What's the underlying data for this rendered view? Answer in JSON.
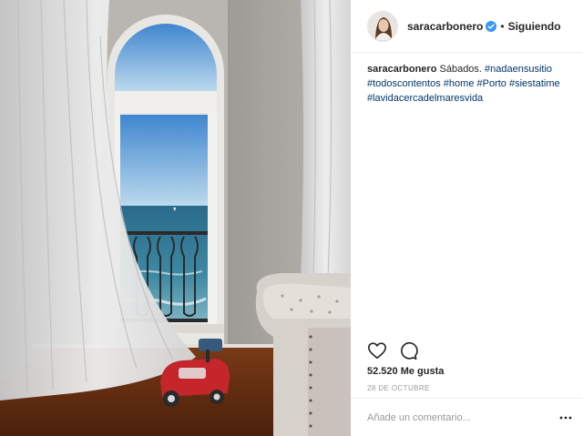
{
  "post": {
    "username": "saracarbonero",
    "separator": "•",
    "follow_state": "Siguiendo",
    "caption": {
      "username": "saracarbonero",
      "text": "Sábados.",
      "hashtags": [
        "#nadaensusitio",
        "#todoscontentos",
        "#home",
        "#Porto",
        "#siestatime",
        "#lavidacercadelmaresvida"
      ]
    },
    "likes": "52.520 Me gusta",
    "date": "28 DE OCTUBRE",
    "comment_placeholder": "Añade un comentario...",
    "more_label": "..."
  },
  "icons": {
    "verified": "verified-badge-icon",
    "like": "heart-outline-icon",
    "comment": "speech-bubble-icon",
    "more": "ellipsis-icon"
  },
  "colors": {
    "hashtag": "#003569",
    "verified": "#3897f0",
    "text": "#262626",
    "muted": "#999999"
  }
}
